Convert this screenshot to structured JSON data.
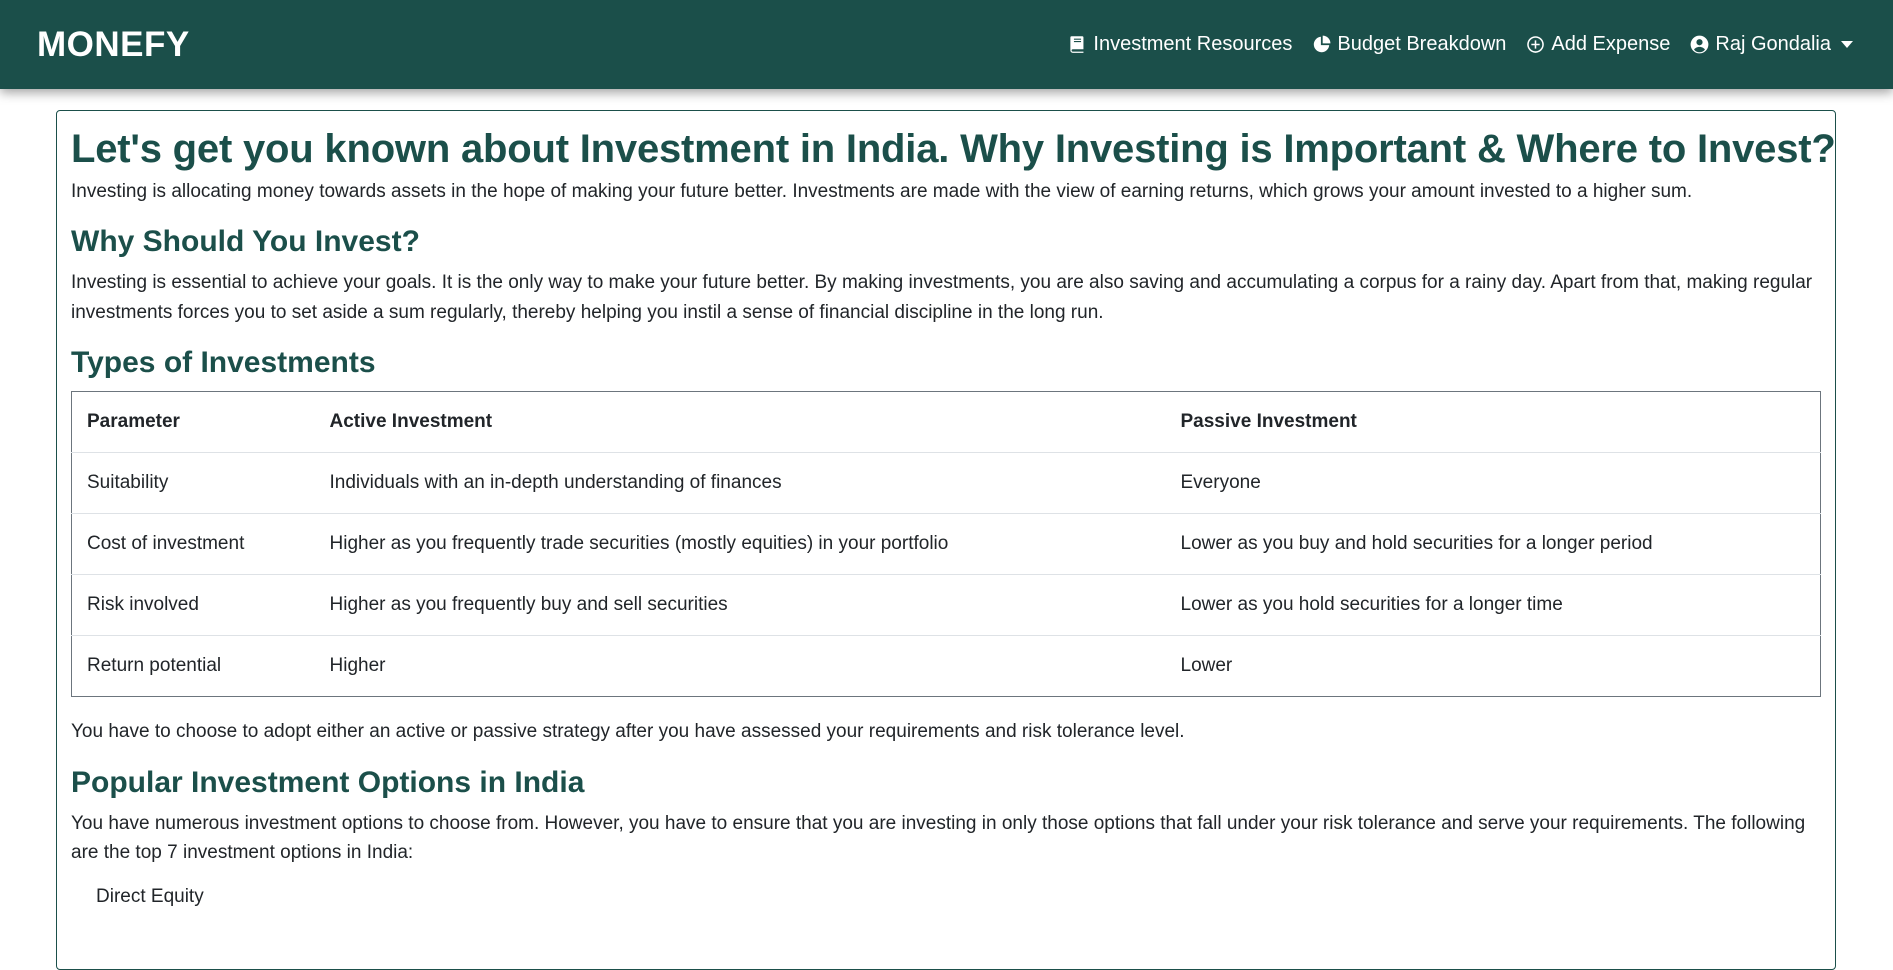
{
  "nav": {
    "brand": "MONEFY",
    "links": [
      {
        "label": "Investment Resources",
        "icon": "book-icon"
      },
      {
        "label": "Budget Breakdown",
        "icon": "pie-chart-icon"
      },
      {
        "label": "Add Expense",
        "icon": "plus-circle-icon"
      }
    ],
    "user": {
      "label": "Raj Gondalia",
      "icon": "user-circle-icon"
    }
  },
  "content": {
    "title": "Let's get you known about Investment in India. Why Investing is Important & Where to Invest?",
    "intro": "Investing is allocating money towards assets in the hope of making your future better. Investments are made with the view of earning returns, which grows your amount invested to a higher sum.",
    "why_heading": "Why Should You Invest?",
    "why_text": "Investing is essential to achieve your goals. It is the only way to make your future better. By making investments, you are also saving and accumulating a corpus for a rainy day. Apart from that, making regular investments forces you to set aside a sum regularly, thereby helping you instil a sense of financial discipline in the long run.",
    "types_heading": "Types of Investments",
    "table": {
      "headers": [
        "Parameter",
        "Active Investment",
        "Passive Investment"
      ],
      "rows": [
        [
          "Suitability",
          "Individuals with an in-depth understanding of finances",
          "Everyone"
        ],
        [
          "Cost of investment",
          "Higher as you frequently trade securities (mostly equities) in your portfolio",
          "Lower as you buy and hold securities for a longer period"
        ],
        [
          "Risk involved",
          "Higher as you frequently buy and sell securities",
          "Lower as you hold securities for a longer time"
        ],
        [
          "Return potential",
          "Higher",
          "Lower"
        ]
      ]
    },
    "strategy_text": "You have to choose to adopt either an active or passive strategy after you have assessed your requirements and risk tolerance level.",
    "popular_heading": "Popular Investment Options in India",
    "popular_text": "You have numerous investment options to choose from. However, you have to ensure that you are investing in only those options that fall under your risk tolerance and serve your requirements. The following are the top 7 investment options in India:",
    "options": [
      "Direct Equity"
    ]
  },
  "colors": {
    "primary": "#1b4f4a",
    "text": "#212529"
  }
}
